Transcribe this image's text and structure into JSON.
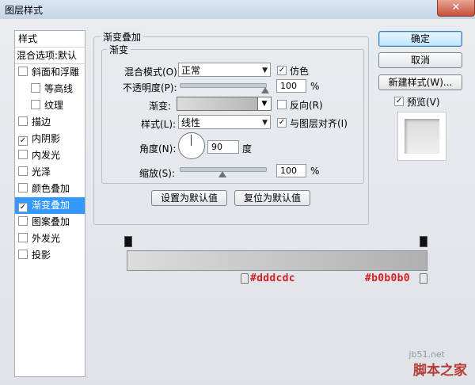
{
  "window": {
    "title": "图层样式"
  },
  "sidebar": {
    "header": "样式",
    "blend_options": "混合选项:默认",
    "items": [
      {
        "label": "斜面和浮雕",
        "checked": false,
        "indent": false
      },
      {
        "label": "等高线",
        "checked": false,
        "indent": true
      },
      {
        "label": "纹理",
        "checked": false,
        "indent": true
      },
      {
        "label": "描边",
        "checked": false,
        "indent": false
      },
      {
        "label": "内阴影",
        "checked": true,
        "indent": false
      },
      {
        "label": "内发光",
        "checked": false,
        "indent": false
      },
      {
        "label": "光泽",
        "checked": false,
        "indent": false
      },
      {
        "label": "颜色叠加",
        "checked": false,
        "indent": false
      },
      {
        "label": "渐变叠加",
        "checked": true,
        "indent": false,
        "active": true
      },
      {
        "label": "图案叠加",
        "checked": false,
        "indent": false
      },
      {
        "label": "外发光",
        "checked": false,
        "indent": false
      },
      {
        "label": "投影",
        "checked": false,
        "indent": false
      }
    ]
  },
  "panel": {
    "group_title": "渐变叠加",
    "subgroup_title": "渐变",
    "blend_mode_label": "混合模式(O):",
    "blend_mode_value": "正常",
    "dither_label": "仿色",
    "dither_checked": true,
    "opacity_label": "不透明度(P):",
    "opacity_value": "100",
    "opacity_unit": "%",
    "opacity_level": 1.0,
    "gradient_label": "渐变:",
    "reverse_label": "反向(R)",
    "reverse_checked": false,
    "style_label": "样式(L):",
    "style_value": "线性",
    "align_label": "与图层对齐(I)",
    "align_checked": true,
    "angle_label": "角度(N):",
    "angle_value": "90",
    "angle_unit": "度",
    "scale_label": "缩放(S):",
    "scale_value": "100",
    "scale_unit": "%",
    "scale_level": 0.5,
    "set_default_button": "设置为默认值",
    "reset_default_button": "复位为默认值"
  },
  "actions": {
    "ok": "确定",
    "cancel": "取消",
    "new_style": "新建样式(W)...",
    "preview_label": "预览(V)",
    "preview_checked": true
  },
  "gradient": {
    "start_color": "#dddcdc",
    "end_color": "#b0b0b0",
    "start_label": "#dddcdc",
    "end_label": "#b0b0b0"
  },
  "watermark": {
    "site": "jb51.net",
    "brand": "脚本之家"
  },
  "colors": {
    "accent": "#3399ff",
    "label_red": "#d42020"
  }
}
